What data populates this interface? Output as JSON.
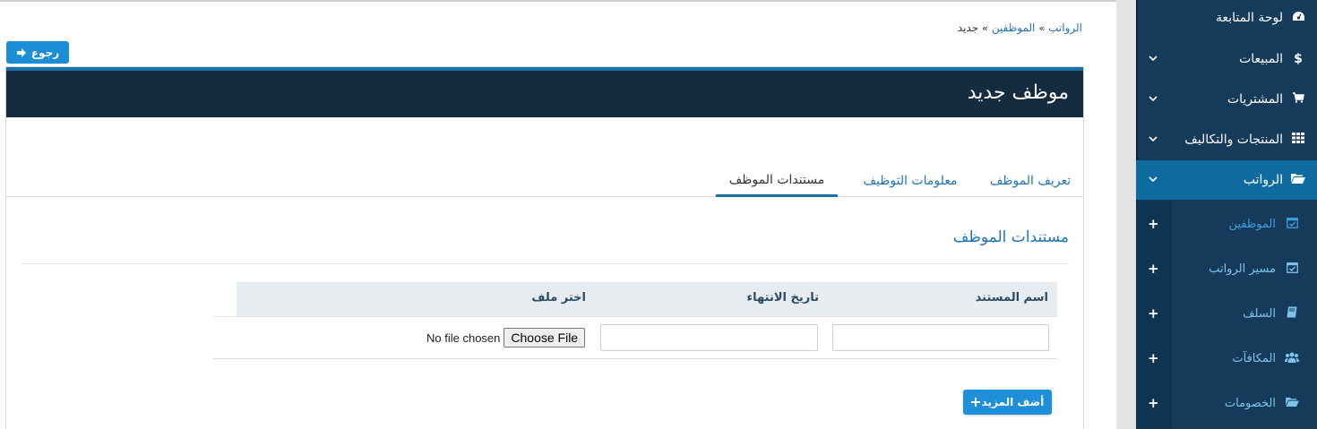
{
  "breadcrumb": {
    "items": [
      "الرواتب",
      "الموظفين"
    ],
    "current": "جديد",
    "separator": "»"
  },
  "back_button": {
    "label": "رجوع",
    "icon": "arrow-right-icon"
  },
  "panel": {
    "title": "موظف جديد"
  },
  "tabs": [
    {
      "label": "تعريف الموظف",
      "active": false
    },
    {
      "label": "معلومات التوظيف",
      "active": false
    },
    {
      "label": "مستندات الموظف",
      "active": true
    }
  ],
  "section": {
    "title": "مستندات الموظف"
  },
  "table": {
    "headers": [
      "اسم المستند",
      "تاريخ الانتهاء",
      "اختر ملف"
    ],
    "row": {
      "doc_name": "",
      "expiry_date": ""
    }
  },
  "file_input": {
    "button_label": "Choose File",
    "status": "No file chosen"
  },
  "add_more_button": {
    "label": "أضف المزيد",
    "icon": "plus-icon"
  },
  "sidebar": {
    "items": [
      {
        "label": "لوحة المتابعة",
        "icon": "dashboard-icon",
        "has_chevron": false
      },
      {
        "label": "المبيعات",
        "icon": "dollar-icon",
        "has_chevron": true
      },
      {
        "label": "المشتريات",
        "icon": "cart-icon",
        "has_chevron": true
      },
      {
        "label": "المنتجات والتكاليف",
        "icon": "grid-icon",
        "has_chevron": true
      },
      {
        "label": "الرواتب",
        "icon": "folder-open-icon",
        "has_chevron": true,
        "active": true
      }
    ],
    "subitems": [
      {
        "label": "الموظفين",
        "icon": "calendar-check-icon",
        "current": true
      },
      {
        "label": "مسير الرواتب",
        "icon": "calendar-check-icon"
      },
      {
        "label": "السلف",
        "icon": "book-icon"
      },
      {
        "label": "المكافآت",
        "icon": "users-icon"
      },
      {
        "label": "الخصومات",
        "icon": "folder-open-icon"
      }
    ]
  },
  "colors": {
    "sidebar_bg": "#163a5a",
    "sidebar_active": "#0e6ba0",
    "panel_header": "#152b40",
    "accent": "#1b8ed7",
    "link": "#1f74b7"
  }
}
